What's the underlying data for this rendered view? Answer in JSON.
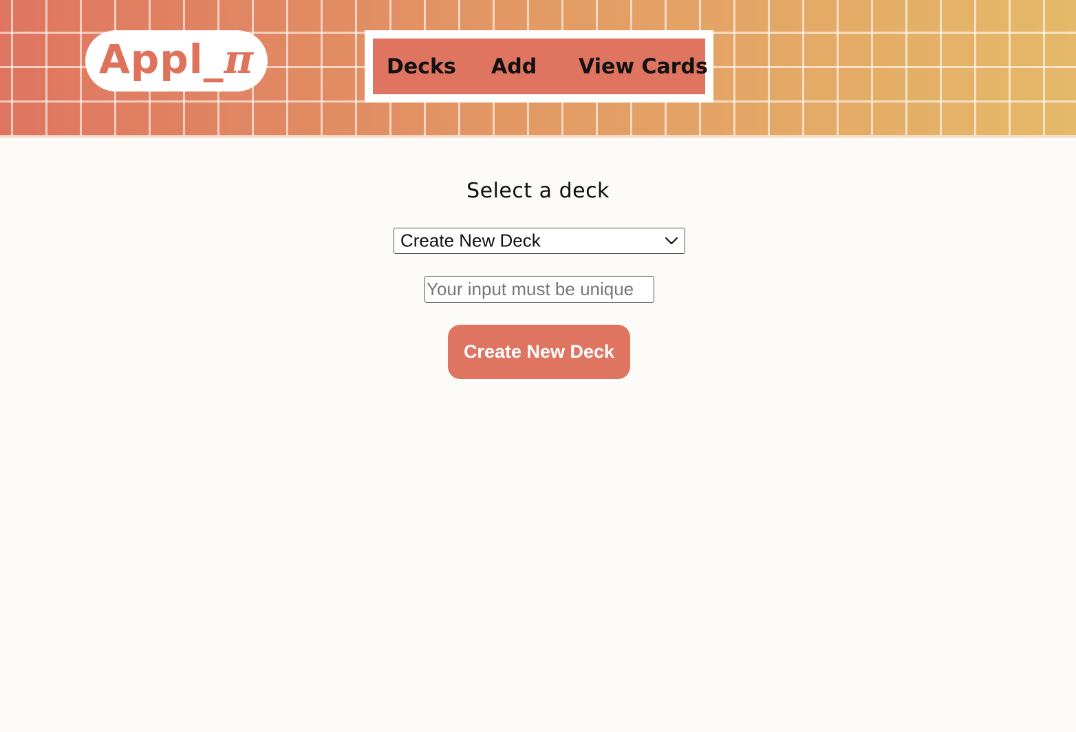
{
  "header": {
    "logo_main": "Appl_",
    "logo_pi": "π",
    "nav": [
      {
        "label": "Decks"
      },
      {
        "label": "Add"
      },
      {
        "label": "View Cards"
      }
    ]
  },
  "main": {
    "heading": "Select a deck",
    "deck_select": {
      "selected": "Create New Deck",
      "icon": "chevron-down-icon"
    },
    "deck_name_input": {
      "value": "",
      "placeholder": "Your input must be unique"
    },
    "create_button_label": "Create New Deck"
  },
  "colors": {
    "accent": "#df7460",
    "page_background": "#fcfbf7",
    "header_gradient_start": "#df7560",
    "header_gradient_end": "#e5b969"
  }
}
